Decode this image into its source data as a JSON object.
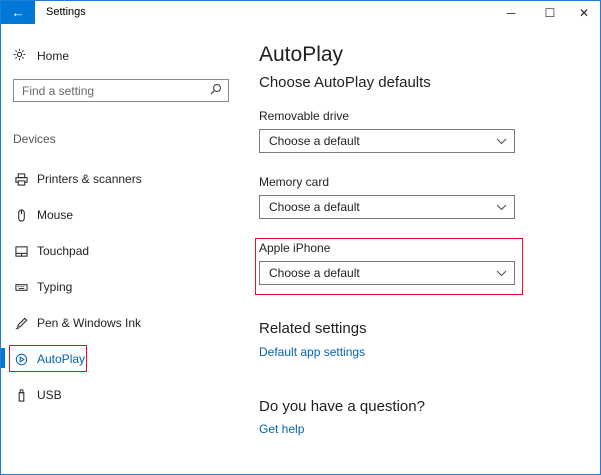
{
  "titlebar": {
    "back_glyph": "←",
    "title": "Settings",
    "minimize_glyph": "─",
    "maximize_glyph": "☐",
    "close_glyph": "✕"
  },
  "nav": {
    "home_label": "Home",
    "search_placeholder": "Find a setting",
    "section_label": "Devices",
    "items": [
      {
        "label": "Printers & scanners",
        "icon": "printer-icon"
      },
      {
        "label": "Mouse",
        "icon": "mouse-icon"
      },
      {
        "label": "Touchpad",
        "icon": "touchpad-icon"
      },
      {
        "label": "Typing",
        "icon": "keyboard-icon"
      },
      {
        "label": "Pen & Windows Ink",
        "icon": "pen-icon"
      },
      {
        "label": "AutoPlay",
        "icon": "autoplay-icon",
        "active": true
      },
      {
        "label": "USB",
        "icon": "usb-icon"
      }
    ]
  },
  "main": {
    "title": "AutoPlay",
    "subtitle": "Choose AutoPlay defaults",
    "fields": [
      {
        "label": "Removable drive",
        "value": "Choose a default"
      },
      {
        "label": "Memory card",
        "value": "Choose a default"
      },
      {
        "label": "Apple iPhone",
        "value": "Choose a default"
      }
    ],
    "related_heading": "Related settings",
    "related_link": "Default app settings",
    "question_heading": "Do you have a question?",
    "help_link": "Get help"
  },
  "colors": {
    "accent": "#0078d7",
    "link": "#0063b1",
    "highlight": "#e81123"
  }
}
